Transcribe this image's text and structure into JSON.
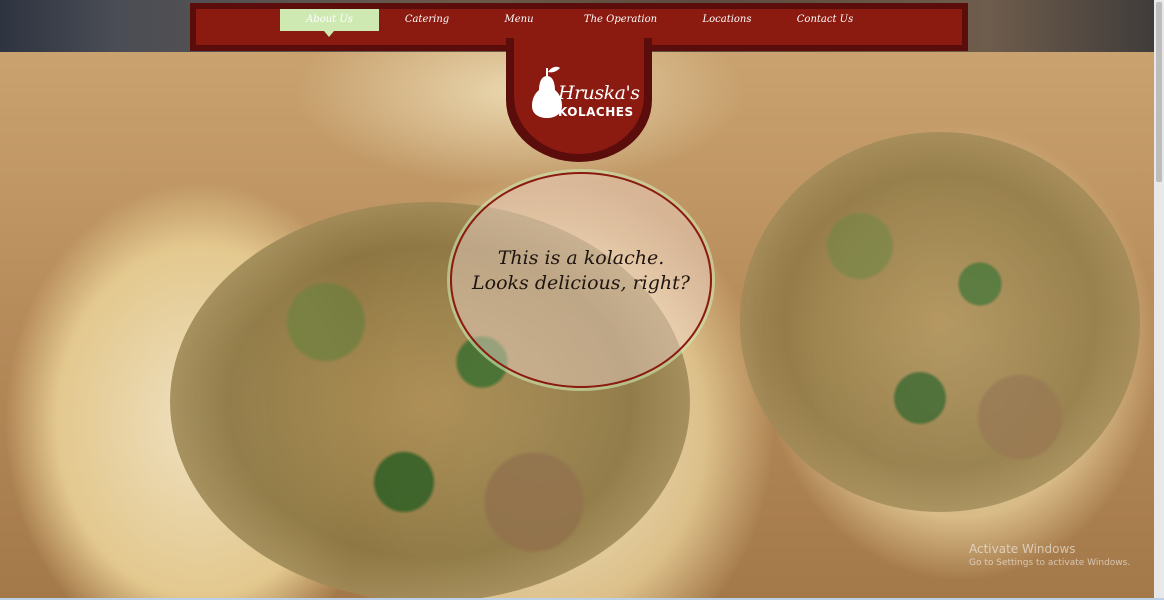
{
  "nav": {
    "items": [
      {
        "label": "About Us",
        "active": true
      },
      {
        "label": "Catering",
        "active": false
      },
      {
        "label": "Menu",
        "active": false
      },
      {
        "label": "The Operation",
        "active": false
      },
      {
        "label": "Locations",
        "active": false
      },
      {
        "label": "Contact Us",
        "active": false
      }
    ]
  },
  "logo": {
    "line1": "Hruska's",
    "line2": "KOLACHES",
    "icon": "pear-icon"
  },
  "hero": {
    "bubble_line1": "This is a kolache.",
    "bubble_line2": "Looks delicious, right?"
  },
  "watermark": {
    "title": "Activate Windows",
    "subtitle": "Go to Settings to activate Windows."
  },
  "colors": {
    "nav_dark": "#5a0d0a",
    "nav_red": "#8b1a10",
    "nav_active": "#cfe9b3"
  }
}
